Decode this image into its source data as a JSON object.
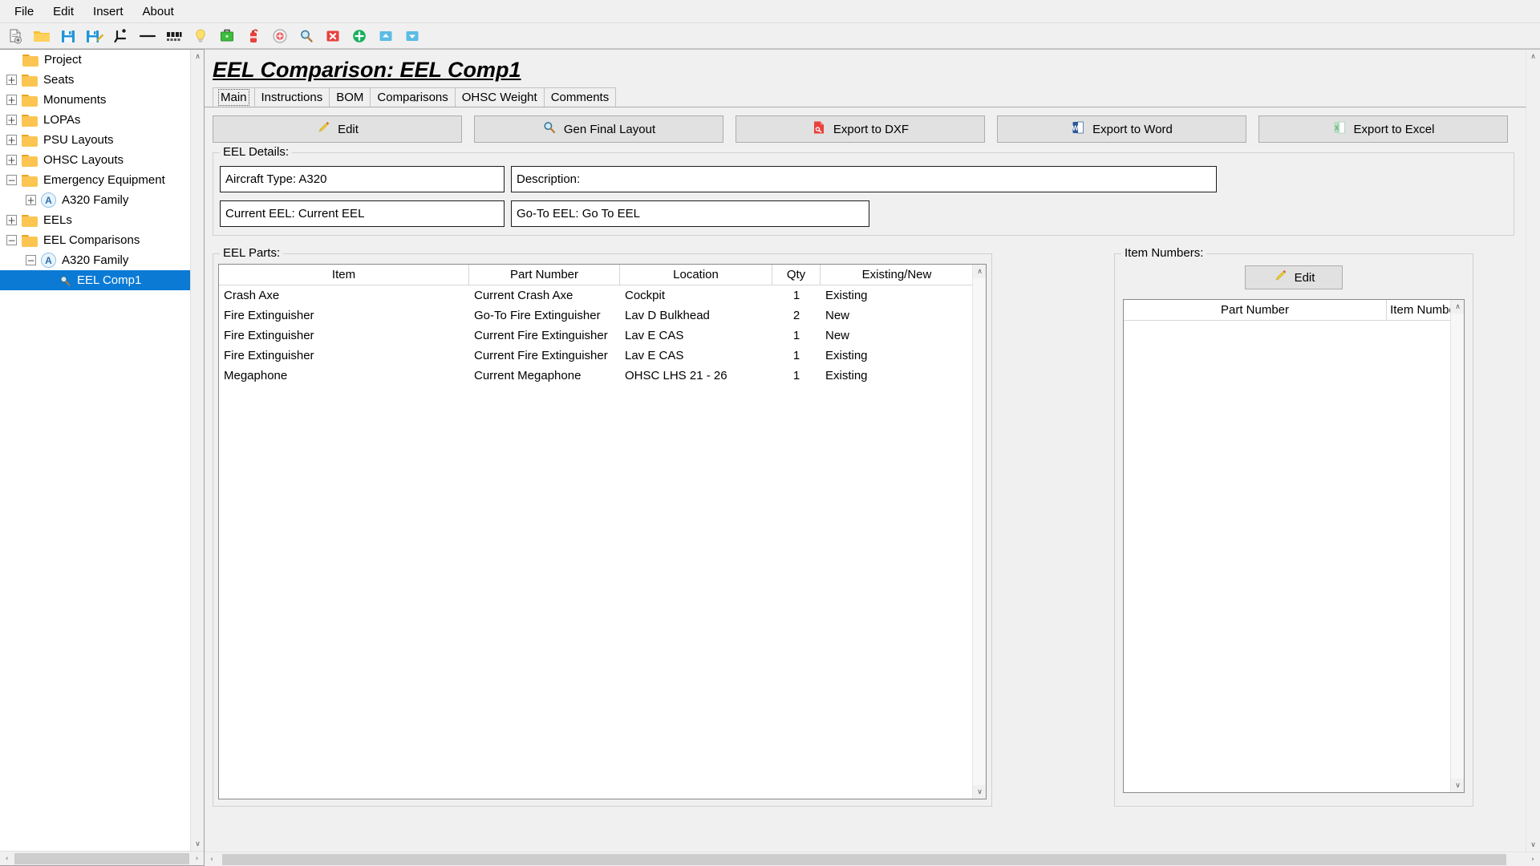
{
  "menubar": {
    "items": [
      {
        "label": "File"
      },
      {
        "label": "Edit"
      },
      {
        "label": "Insert"
      },
      {
        "label": "About"
      }
    ]
  },
  "toolbar": {
    "buttons": [
      {
        "name": "new-document-icon",
        "tooltip": "New"
      },
      {
        "name": "open-folder-icon",
        "tooltip": "Open"
      },
      {
        "name": "save-icon",
        "tooltip": "Save"
      },
      {
        "name": "save-as-icon",
        "tooltip": "Save As"
      },
      {
        "name": "seat-icon",
        "tooltip": "Seat"
      },
      {
        "name": "line-icon",
        "tooltip": "Line"
      },
      {
        "name": "seat-row-icon",
        "tooltip": "Seat Row"
      },
      {
        "name": "lightbulb-icon",
        "tooltip": "PSU"
      },
      {
        "name": "briefcase-icon",
        "tooltip": "Monument"
      },
      {
        "name": "fire-extinguisher-icon",
        "tooltip": "Emergency Equipment"
      },
      {
        "name": "target-icon",
        "tooltip": "Locate"
      },
      {
        "name": "magnifier-icon",
        "tooltip": "Zoom"
      },
      {
        "name": "delete-icon",
        "tooltip": "Delete"
      },
      {
        "name": "add-icon",
        "tooltip": "Add"
      },
      {
        "name": "up-icon",
        "tooltip": "Move Up"
      },
      {
        "name": "down-icon",
        "tooltip": "Move Down"
      }
    ]
  },
  "tree": {
    "items": [
      {
        "label": "Project",
        "indent": 0,
        "expander": "none",
        "icon": "folder-icon",
        "selected": false
      },
      {
        "label": "Seats",
        "indent": 0,
        "expander": "plus",
        "icon": "folder-icon",
        "selected": false
      },
      {
        "label": "Monuments",
        "indent": 0,
        "expander": "plus",
        "icon": "folder-icon",
        "selected": false
      },
      {
        "label": "LOPAs",
        "indent": 0,
        "expander": "plus",
        "icon": "folder-icon",
        "selected": false
      },
      {
        "label": "PSU Layouts",
        "indent": 0,
        "expander": "plus",
        "icon": "folder-icon",
        "selected": false
      },
      {
        "label": "OHSC Layouts",
        "indent": 0,
        "expander": "plus",
        "icon": "folder-icon",
        "selected": false
      },
      {
        "label": "Emergency Equipment",
        "indent": 0,
        "expander": "minus",
        "icon": "folder-icon",
        "selected": false
      },
      {
        "label": "A320 Family",
        "indent": 1,
        "expander": "plus",
        "icon": "aircraft-icon",
        "selected": false
      },
      {
        "label": "EELs",
        "indent": 0,
        "expander": "plus",
        "icon": "folder-icon",
        "selected": false
      },
      {
        "label": "EEL Comparisons",
        "indent": 0,
        "expander": "minus",
        "icon": "folder-icon",
        "selected": false
      },
      {
        "label": "A320 Family",
        "indent": 1,
        "expander": "minus",
        "icon": "aircraft-icon",
        "selected": false
      },
      {
        "label": "EEL Comp1",
        "indent": 2,
        "expander": "none",
        "icon": "magnifier-icon",
        "selected": true
      }
    ]
  },
  "page": {
    "title": "EEL Comparison: EEL Comp1"
  },
  "tabs": [
    {
      "label": "Main",
      "active": true
    },
    {
      "label": "Instructions",
      "active": false
    },
    {
      "label": "BOM",
      "active": false
    },
    {
      "label": "Comparisons",
      "active": false
    },
    {
      "label": "OHSC Weight",
      "active": false
    },
    {
      "label": "Comments",
      "active": false
    }
  ],
  "actions": [
    {
      "label": "Edit",
      "icon": "pencil-icon"
    },
    {
      "label": "Gen Final Layout",
      "icon": "magnifier-icon"
    },
    {
      "label": "Export to DXF",
      "icon": "dxf-file-icon"
    },
    {
      "label": "Export to Word",
      "icon": "word-file-icon"
    },
    {
      "label": "Export to Excel",
      "icon": "excel-file-icon"
    }
  ],
  "details": {
    "group_title": "EEL Details:",
    "aircraft_type": "Aircraft Type: A320",
    "description": "Description:",
    "current_eel": "Current EEL: Current EEL",
    "goto_eel": "Go-To EEL: Go To EEL"
  },
  "parts": {
    "group_title": "EEL Parts:",
    "columns": [
      "Item",
      "Part Number",
      "Location",
      "Qty",
      "Existing/New"
    ],
    "rows": [
      {
        "item": "Crash Axe",
        "part_number": "Current Crash Axe",
        "location": "Cockpit",
        "qty": "1",
        "status": "Existing"
      },
      {
        "item": "Fire Extinguisher",
        "part_number": "Go-To Fire Extinguisher",
        "location": "Lav D Bulkhead",
        "qty": "2",
        "status": "New"
      },
      {
        "item": "Fire Extinguisher",
        "part_number": "Current Fire Extinguisher",
        "location": "Lav E CAS",
        "qty": "1",
        "status": "New"
      },
      {
        "item": "Fire Extinguisher",
        "part_number": "Current Fire Extinguisher",
        "location": "Lav E CAS",
        "qty": "1",
        "status": "Existing"
      },
      {
        "item": "Megaphone",
        "part_number": "Current Megaphone",
        "location": "OHSC LHS 21 - 26",
        "qty": "1",
        "status": "Existing"
      }
    ]
  },
  "item_numbers": {
    "group_title": "Item Numbers:",
    "edit_label": "Edit",
    "columns": [
      "Part Number",
      "Item Number"
    ],
    "rows": []
  },
  "colors": {
    "selection_blue": "#0b7ad5",
    "folder_yellow": "#fcc552",
    "window_bg": "#f0f0f0",
    "list_bg": "#ffffff",
    "border_gray": "#a0a0a0"
  },
  "scrollbars": {
    "up_arrow": "∧",
    "down_arrow": "∨",
    "left_arrow": "‹",
    "right_arrow": "›"
  }
}
